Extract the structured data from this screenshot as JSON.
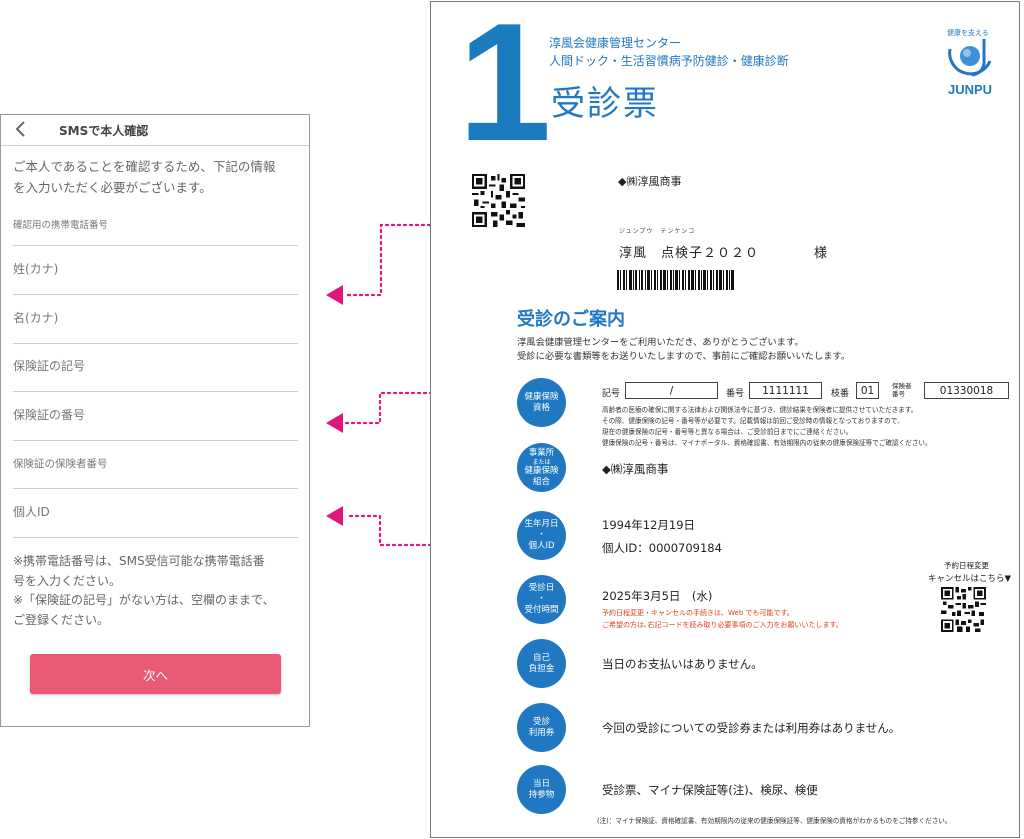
{
  "phone": {
    "header_title": "SMSで本人確認",
    "intro_line1": "ご本人であることを確認するため、下記の情報",
    "intro_line2": "を入力いただく必要がございます。",
    "fields": [
      {
        "label": "確認用の携帯電話番号"
      },
      {
        "label": "姓(カナ)"
      },
      {
        "label": "名(カナ)"
      },
      {
        "label": "保険証の記号"
      },
      {
        "label": "保険証の番号"
      },
      {
        "label": "保険証の保険者番号"
      },
      {
        "label": "個人ID"
      }
    ],
    "note_line1": "※携帯電話番号は、SMS受信可能な携帯電話番",
    "note_line2": "号を入力ください。",
    "note_line3": "※「保険証の記号」がない方は、空欄のままで、",
    "note_line4": "ご登録ください。",
    "next_button": "次へ",
    "accent_color": "#ea5974"
  },
  "document": {
    "big_number": "1",
    "org_line1": "淳風会健康管理センター",
    "org_line2": "人間ドック・生活習慣病予防健診・健康診断",
    "title": "受診票",
    "logo_tagline": "健康を支える",
    "logo_text": "JUNPU",
    "company_top": "◆㈱淳風商事",
    "furigana": "ジュンプウ　テンケンコ",
    "patient_name": "淳風　点検子２０２０",
    "honorific": "様",
    "guide_title": "受診のご案内",
    "guide_line1": "淳風会健康管理センターをご利用いただき、ありがとうございます。",
    "guide_line2": "受診に必要な書類等をお送りいたしますので、事前にご確認お願いいたします。",
    "insurance": {
      "circle_line1": "健康保険",
      "circle_line2": "資格",
      "kigou_label": "記号",
      "kigou_value": "/",
      "bangou_label": "番号",
      "bangou_value": "1111111",
      "edaban_label": "枝番",
      "edaban_value": "01",
      "hokensha_label1": "保険者",
      "hokensha_label2": "番号",
      "hokensha_value": "01330018",
      "note1": "高齢者の医療の確保に関する法律および関係法令に基づき、健診結果を保険者に提供させていただきます。",
      "note2": "その際、健康保険の記号・番号等が必要です。記載情報は前回ご受診時の情報となっておりますので、",
      "note3": "現在の健康保険の記号・番号等と異なる場合は、ご受診前日までにご連絡ください。",
      "note4": "健康保険の記号・番号は、マイナポータル、資格確認書、有効期限内の従来の健康保険証等でご確認ください。"
    },
    "office": {
      "circle_line1": "事業所",
      "circle_line2": "または",
      "circle_line3": "健康保険",
      "circle_line4": "組合",
      "value": "◆㈱淳風商事"
    },
    "birth": {
      "circle_line1": "生年月日",
      "circle_line2": "・",
      "circle_line3": "個人ID",
      "birth_value": "1994年12月19日",
      "id_value": "個人ID：0000709184"
    },
    "visit": {
      "circle_line1": "受診日",
      "circle_line2": "・",
      "circle_line3": "受付時間",
      "date_value": "2025年3月5日　(水)",
      "red1": "予約日程変更・キャンセルの手続きは、Web でも可能です。",
      "red2": "ご希望の方は､右記コードを読み取り必要事項のご入力をお願いいたします。",
      "rebook_line1": "予約日程変更",
      "rebook_line2": "キャンセルはこちら▼"
    },
    "payment": {
      "circle_line1": "自己",
      "circle_line2": "負担金",
      "value": "当日のお支払いはありません。"
    },
    "voucher": {
      "circle_line1": "受診",
      "circle_line2": "利用券",
      "value": "今回の受診についての受診券または利用券はありません。"
    },
    "items": {
      "circle_line1": "当日",
      "circle_line2": "持参物",
      "value": "受診票、マイナ保険証等(注)、検尿、検便",
      "footnote": "(注)：マイナ保険証、資格確認書、有効期限内の従来の健康保険証等、健康保険の資格がわかるものをご持参ください。"
    },
    "brand_color": "#1f78c1"
  },
  "connector_color": "#e0177b"
}
